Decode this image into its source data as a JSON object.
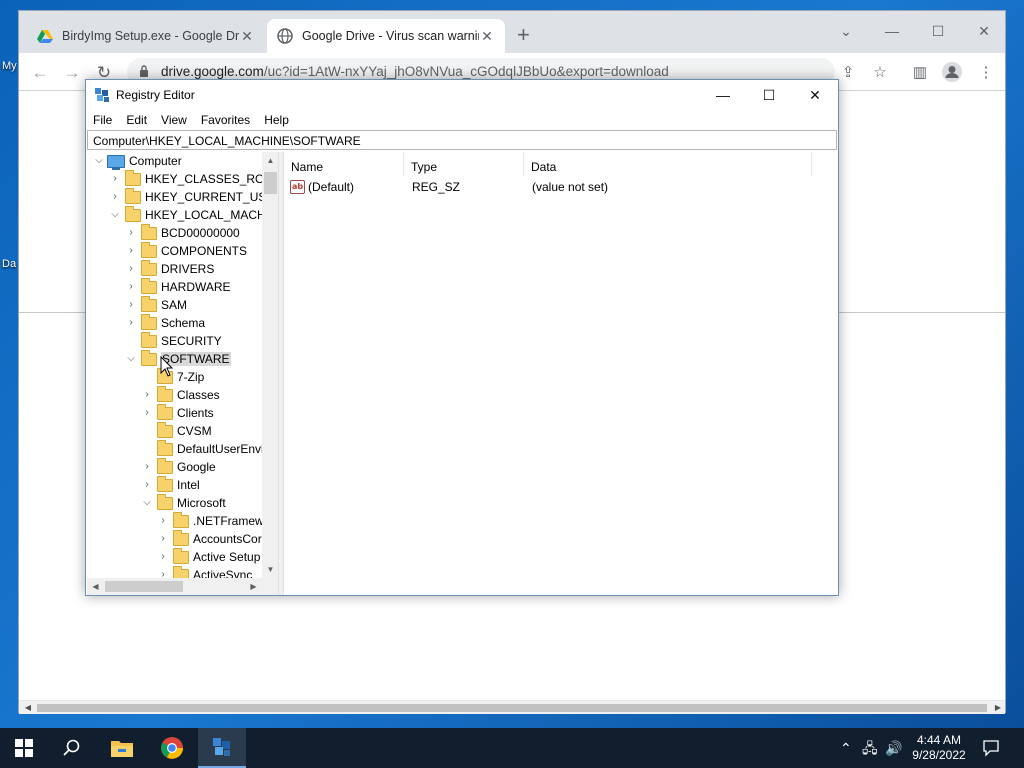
{
  "desktop": {
    "labels": [
      "My",
      "Da"
    ]
  },
  "browser": {
    "tabs": [
      {
        "title": "BirdyImg Setup.exe - Google Dri",
        "close": "✕"
      },
      {
        "title": "Google Drive - Virus scan warnin",
        "close": "✕"
      }
    ],
    "new_tab": "+",
    "url_host": "drive.google.com",
    "url_rest": "/uc?id=1AtW-nxYYaj_jhO8vNVua_cGOdqlJBbUo&export=download"
  },
  "regedit": {
    "title": "Registry Editor",
    "menu": [
      "File",
      "Edit",
      "View",
      "Favorites",
      "Help"
    ],
    "address": "Computer\\HKEY_LOCAL_MACHINE\\SOFTWARE",
    "tree": [
      "Computer",
      "HKEY_CLASSES_ROOT",
      "HKEY_CURRENT_USER",
      "HKEY_LOCAL_MACHI",
      "BCD00000000",
      "COMPONENTS",
      "DRIVERS",
      "HARDWARE",
      "SAM",
      "Schema",
      "SECURITY",
      "SOFTWARE",
      "7-Zip",
      "Classes",
      "Clients",
      "CVSM",
      "DefaultUserEnvi",
      "Google",
      "Intel",
      "Microsoft",
      ".NETFramew",
      "AccountsCor",
      "Active Setup",
      "ActiveSync"
    ],
    "columns": [
      "Name",
      "Type",
      "Data"
    ],
    "rows": [
      {
        "name": "(Default)",
        "type": "REG_SZ",
        "data": "(value not set)"
      }
    ]
  },
  "taskbar": {
    "time": "4:44 AM",
    "date": "9/28/2022"
  },
  "colors": {
    "accent": "#0078d7",
    "taskbar": "#101e2e",
    "folder": "#f7d26b"
  }
}
